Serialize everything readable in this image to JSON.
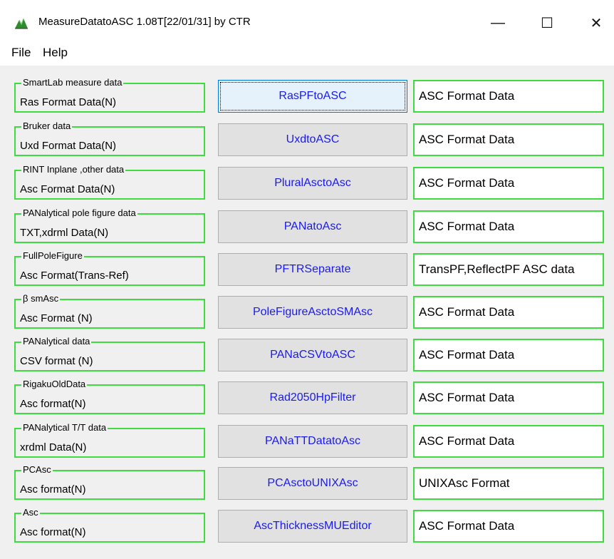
{
  "window": {
    "title": "MeasureDatatoASC 1.08T[22/01/31] by CTR",
    "min_glyph": "—",
    "max_glyph": "☐",
    "close_glyph": "✕"
  },
  "menu": {
    "file": "File",
    "help": "Help"
  },
  "rows": [
    {
      "group_title": "SmartLab measure data",
      "input": "Ras Format Data(N)",
      "button": "RasPFtoASC",
      "output": "ASC Format Data"
    },
    {
      "group_title": "Bruker data",
      "input": "Uxd Format Data(N)",
      "button": "UxdtoASC",
      "output": "ASC Format Data"
    },
    {
      "group_title": "RINT Inplane ,other data",
      "input": "Asc Format Data(N)",
      "button": "PluralAsctoAsc",
      "output": "ASC Format Data"
    },
    {
      "group_title": "PANalytical pole figure data",
      "input": "TXT,xdrml Data(N)",
      "button": "PANatoAsc",
      "output": "ASC Format Data"
    },
    {
      "group_title": "FullPoleFigure",
      "input": "Asc Format(Trans-Ref)",
      "button": "PFTRSeparate",
      "output": "TransPF,ReflectPF ASC data"
    },
    {
      "group_title": "β smAsc",
      "input": "Asc Format (N)",
      "button": "PoleFigureAsctoSMAsc",
      "output": "ASC Format Data"
    },
    {
      "group_title": "PANalytical data",
      "input": "CSV format (N)",
      "button": "PANaCSVtoASC",
      "output": "ASC Format Data"
    },
    {
      "group_title": "RigakuOldData",
      "input": "Asc format(N)",
      "button": "Rad2050HpFilter",
      "output": "ASC Format Data"
    },
    {
      "group_title": "PANalytical T/T data",
      "input": "xrdml Data(N)",
      "button": "PANaTTDatatoAsc",
      "output": "ASC Format Data"
    },
    {
      "group_title": "PCAsc",
      "input": "Asc format(N)",
      "button": "PCAsctoUNIXAsc",
      "output": "UNIXAsc Format"
    },
    {
      "group_title": "Asc",
      "input": "Asc format(N)",
      "button": "AscThicknessMUEditor",
      "output": "ASC Format Data"
    }
  ],
  "colors": {
    "group_border": "#3fdc3f",
    "button_text": "#1a1af0",
    "focus_border": "#0078d7"
  }
}
